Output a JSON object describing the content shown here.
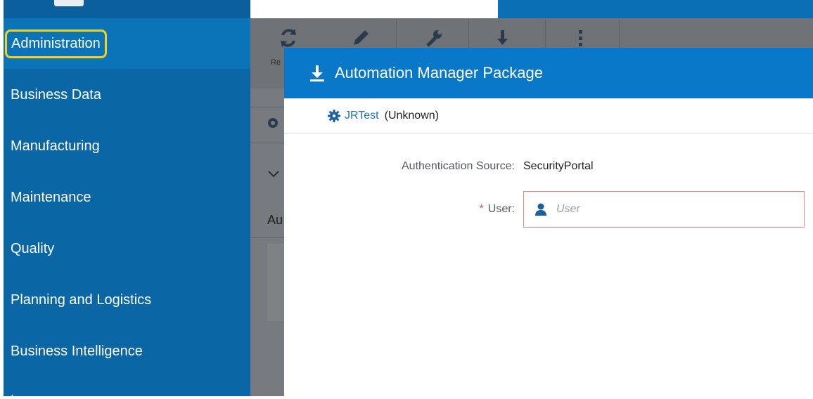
{
  "sidebar": {
    "items": [
      {
        "label": "Administration",
        "active": true
      },
      {
        "label": "Business Data"
      },
      {
        "label": "Manufacturing"
      },
      {
        "label": "Maintenance"
      },
      {
        "label": "Quality"
      },
      {
        "label": "Planning and Logistics"
      },
      {
        "label": "Business Intelligence"
      }
    ],
    "cutoff_text": "."
  },
  "background": {
    "toolbar": {
      "icons": [
        "refresh-icon",
        "edit-pencil-icon",
        "wrench-icon",
        "download-arrow-icon",
        "more-vertical-icon"
      ],
      "visible_label_stub": "Re"
    },
    "text_stub": "Au"
  },
  "dialog": {
    "title": "Automation Manager Package",
    "header_icon": "download-icon",
    "context": {
      "name": "JRTest",
      "state": "(Unknown)",
      "icon": "gear-icon"
    },
    "fields": {
      "auth_source_label": "Authentication Source:",
      "auth_source_value": "SecurityPortal",
      "user_label": "User:",
      "user_required_marker": "*",
      "user_placeholder": "User",
      "user_value": ""
    }
  },
  "colors": {
    "sidebar_bg": "#0a66a4",
    "dialog_header_bg": "#0a78c8",
    "active_outline": "#f2d21b",
    "required": "#d9534f",
    "link": "#1b74c5",
    "input_error_border": "#e5877d"
  }
}
